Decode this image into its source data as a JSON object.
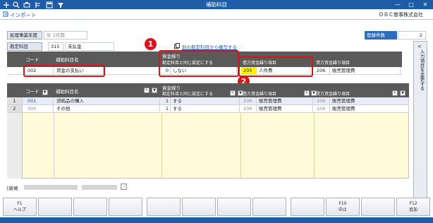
{
  "window": {
    "title": "補助科目",
    "toolbar_icons": [
      "plus-icon",
      "search-icon",
      "print-icon",
      "format-icon",
      "calculator-icon",
      "filter-icon"
    ],
    "controls": {
      "minimize": "—",
      "maximize": "□",
      "close": "✕"
    }
  },
  "import_bar": {
    "label": "インポート",
    "company": "ＯＢＣ慈事株式会社"
  },
  "header": {
    "fiscal_label": "処理事業年度",
    "fiscal_value": "年 3月期",
    "count_label": "登録件数",
    "count_value": "2",
    "account_label": "勘定科目",
    "account_code": "315",
    "account_name": "未払金",
    "copy_link": "別の勘定科目から複写する"
  },
  "edit_table": {
    "headers": {
      "code": "コード",
      "name": "補助科目名",
      "fund_group": "資金繰り",
      "same_setting": "勘定科目と同じ設定にする",
      "debit": "借方資金繰り項目",
      "credit": "貸方資金繰り項目"
    },
    "row": {
      "code": "002",
      "name": "賃金の支払い",
      "same_no": "0",
      "same_text": "しない",
      "debit_code": "205",
      "debit_name": "人件費",
      "credit_code": "206",
      "credit_name": "販売管理費"
    }
  },
  "list_table": {
    "headers": {
      "code": "コード",
      "name": "補助科目名",
      "fund_group": "資金繰り",
      "same_setting": "勘定科目と同じ設定にする",
      "debit": "借方資金繰り項目",
      "credit": "貸方資金繰り項目"
    },
    "rows": [
      {
        "num": "1",
        "code": "001",
        "name": "消耗品の購入",
        "same_no": "1",
        "same_text": "する",
        "debit_code": "206",
        "debit_name": "販売管理費",
        "credit_code": "206",
        "credit_name": "販売管理費"
      },
      {
        "num": "2",
        "code": "000",
        "name": "その他",
        "same_no": "1",
        "same_text": "する",
        "debit_code": "206",
        "debit_name": "販売管理費",
        "credit_code": "206",
        "credit_name": "販売管理費"
      }
    ]
  },
  "callouts": [
    "1",
    "2"
  ],
  "side_panel": {
    "label": "入力項目を変更する",
    "arrow": "<"
  },
  "status": {
    "prefix": "[新規"
  },
  "fkeys": [
    {
      "key": "F1",
      "label": "ヘルプ"
    },
    {
      "key": "",
      "label": ""
    },
    {
      "key": "",
      "label": ""
    },
    {
      "key": "",
      "label": ""
    },
    {
      "key": "",
      "label": ""
    },
    {
      "key": "",
      "label": ""
    },
    {
      "key": "",
      "label": ""
    },
    {
      "key": "",
      "label": ""
    },
    {
      "key": "",
      "label": ""
    },
    {
      "key": "F10",
      "label": "中止"
    },
    {
      "key": "",
      "label": ""
    },
    {
      "key": "F12",
      "label": "追加"
    }
  ],
  "colors": {
    "title_bar": "#1f5ca8",
    "highlight_red": "#d9141c",
    "header_dark": "#5a5a5a",
    "yellow_cell": "#fffbd8"
  }
}
